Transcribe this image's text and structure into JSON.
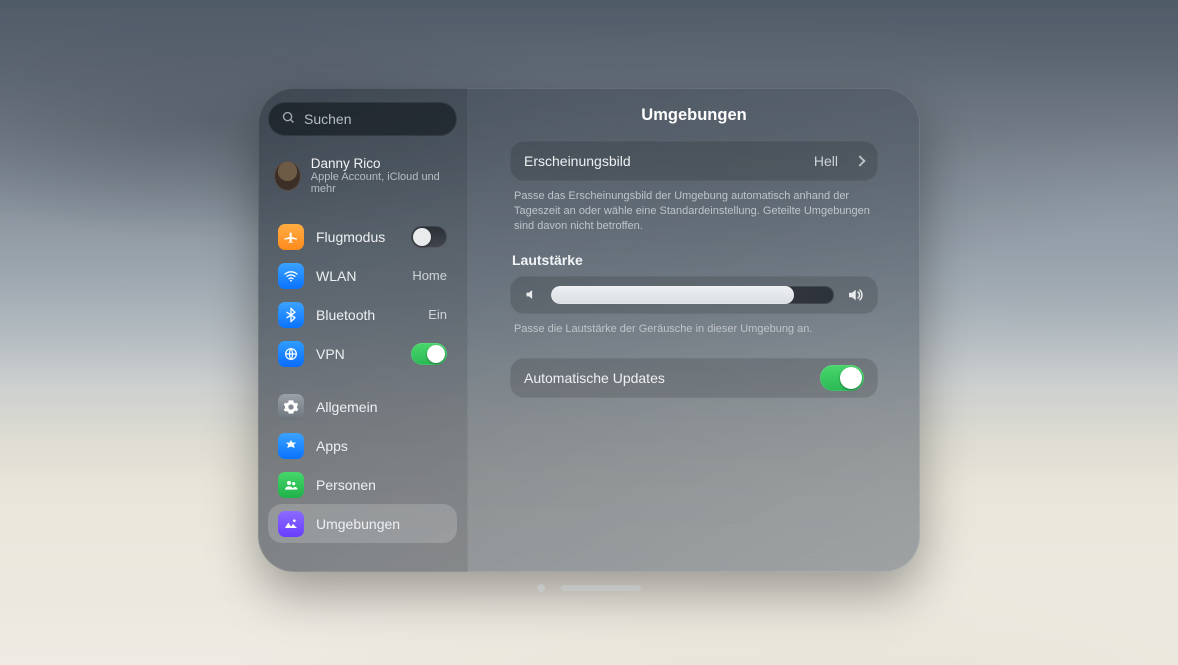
{
  "search": {
    "placeholder": "Suchen"
  },
  "profile": {
    "name": "Danny Rico",
    "subtitle": "Apple Account, iCloud und mehr"
  },
  "sidebar": {
    "quick": [
      {
        "id": "airplane",
        "label": "Flugmodus",
        "icon": "airplane",
        "iconColor": "orange",
        "accessory": "switch",
        "on": false
      },
      {
        "id": "wlan",
        "label": "WLAN",
        "icon": "wifi",
        "iconColor": "blue",
        "accessory": "detail",
        "detail": "Home"
      },
      {
        "id": "bluetooth",
        "label": "Bluetooth",
        "icon": "bluetooth",
        "iconColor": "blue",
        "accessory": "detail",
        "detail": "Ein"
      },
      {
        "id": "vpn",
        "label": "VPN",
        "icon": "globe",
        "iconColor": "blue2",
        "accessory": "switch",
        "on": true
      }
    ],
    "settings": [
      {
        "id": "general",
        "label": "Allgemein",
        "icon": "gear",
        "iconColor": "gray",
        "selected": false
      },
      {
        "id": "apps",
        "label": "Apps",
        "icon": "appstore",
        "iconColor": "blue",
        "selected": false
      },
      {
        "id": "people",
        "label": "Personen",
        "icon": "people",
        "iconColor": "green",
        "selected": false
      },
      {
        "id": "environments",
        "label": "Umgebungen",
        "icon": "landscape",
        "iconColor": "purple",
        "selected": true
      }
    ]
  },
  "main": {
    "title": "Umgebungen",
    "appearance": {
      "label": "Erscheinungsbild",
      "value": "Hell",
      "caption": "Passe das Erscheinungsbild der Umgebung automatisch anhand der Tageszeit an oder wähle eine Standardeinstellung. Geteilte Umgebungen sind davon nicht betroffen."
    },
    "volume": {
      "heading": "Lautstärke",
      "percent": 86,
      "caption": "Passe die Lautstärke der Geräusche in dieser Umgebung an."
    },
    "autoUpdates": {
      "label": "Automatische Updates",
      "on": true
    }
  }
}
